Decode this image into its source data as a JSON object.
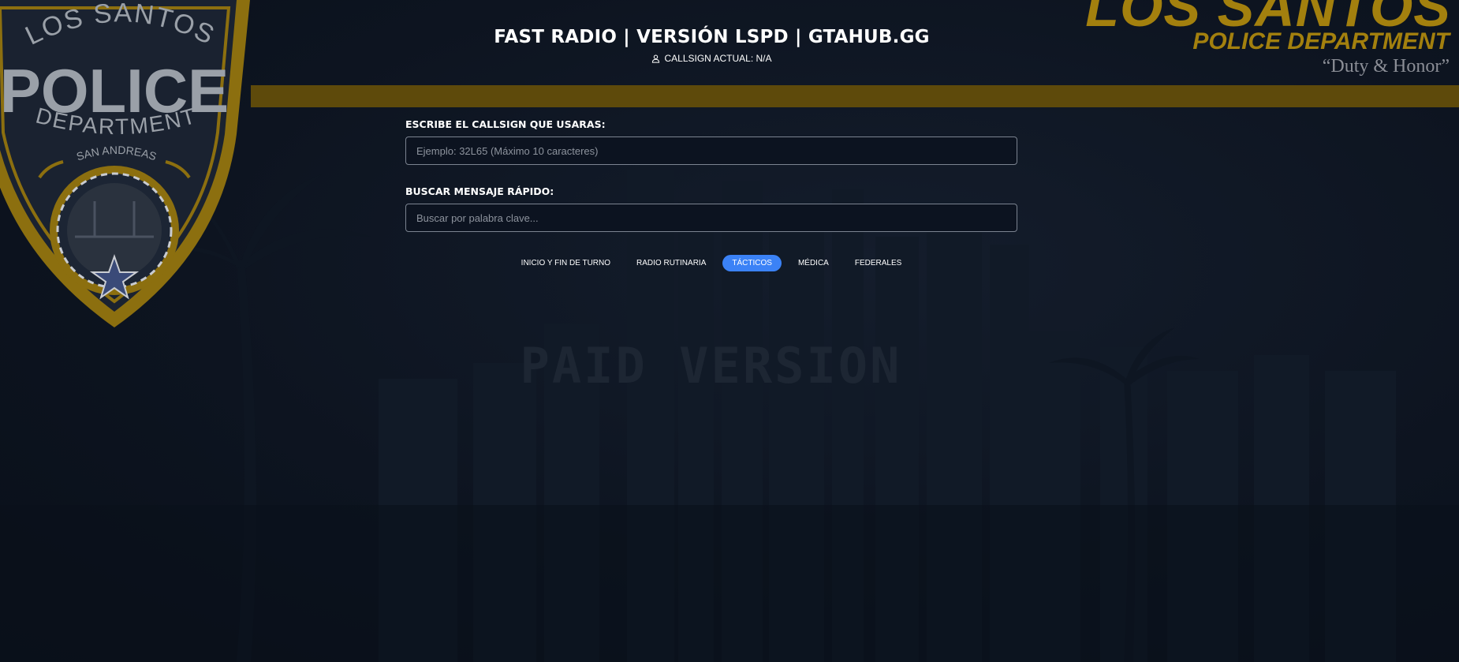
{
  "header": {
    "title": "FAST RADIO | VERSIÓN LSPD | GTAHUB.GG",
    "callsign_status": "CALLSIGN ACTUAL: N/A"
  },
  "branding": {
    "badge_top": "LOS SANTOS",
    "badge_center": "POLICE",
    "badge_dept": "DEPARTMENT",
    "badge_region": "SAN ANDREAS",
    "logo_main": "LOS SANTOS",
    "logo_sub": "POLICE DEPARTMENT",
    "motto": "“Duty & Honor”"
  },
  "form": {
    "callsign_label": "ESCRIBE EL CALLSIGN QUE USARAS:",
    "callsign_placeholder": "Ejemplo: 32L65 (Máximo 10 caracteres)",
    "callsign_value": "",
    "search_label": "BUSCAR MENSAJE RÁPIDO:",
    "search_placeholder": "Buscar por palabra clave...",
    "search_value": ""
  },
  "tabs": [
    {
      "label": "INICIO Y FIN DE TURNO",
      "active": false
    },
    {
      "label": "RADIO RUTINARIA",
      "active": false
    },
    {
      "label": "TÁCTICOS",
      "active": true
    },
    {
      "label": "MÉDICA",
      "active": false
    },
    {
      "label": "FEDERALES",
      "active": false
    }
  ],
  "watermark": "PAID VERSION",
  "colors": {
    "gold": "#a3800e",
    "stripe": "#5e4a0b",
    "active_tab": "#3b82f6",
    "background": "#0b121e"
  }
}
